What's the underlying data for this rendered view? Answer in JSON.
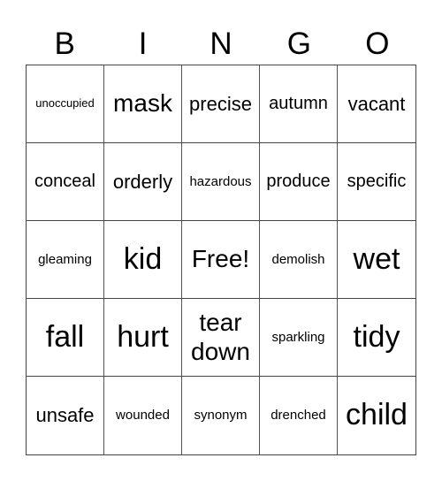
{
  "header": [
    "B",
    "I",
    "N",
    "G",
    "O"
  ],
  "cells": [
    "unoccupied",
    "mask",
    "precise",
    "autumn",
    "vacant",
    "conceal",
    "orderly",
    "hazardous",
    "produce",
    "specific",
    "gleaming",
    "kid",
    "Free!",
    "demolish",
    "wet",
    "fall",
    "hurt",
    "tear down",
    "sparkling",
    "tidy",
    "unsafe",
    "wounded",
    "synonym",
    "drenched",
    "child"
  ]
}
